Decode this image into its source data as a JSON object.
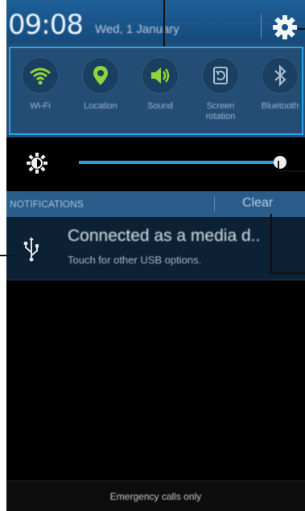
{
  "status_bar": {
    "time": "09:08",
    "date": "Wed, 1 January",
    "settings_icon": "gear-icon"
  },
  "quick_settings": [
    {
      "label": "Wi-Fi",
      "icon": "wifi-icon",
      "active": true
    },
    {
      "label": "Location",
      "icon": "location-icon",
      "active": true
    },
    {
      "label": "Sound",
      "icon": "sound-icon",
      "active": true
    },
    {
      "label": "Screen rotation",
      "icon": "screen-rotation-icon",
      "active": false
    },
    {
      "label": "Bluetooth",
      "icon": "bluetooth-icon",
      "active": false
    }
  ],
  "brightness": {
    "icon": "brightness-icon",
    "level": 1.0
  },
  "notifications": {
    "header": "NOTIFICATIONS",
    "clear_label": "Clear",
    "items": [
      {
        "icon": "usb-icon",
        "title": "Connected as a media d..",
        "subtitle": "Touch for other USB options."
      }
    ]
  },
  "footer": {
    "emergency_text": "Emergency calls only"
  },
  "colors": {
    "accent": "#27a4ee",
    "active_icon": "#8fd43a",
    "inactive_icon": "#a9bdd0"
  }
}
